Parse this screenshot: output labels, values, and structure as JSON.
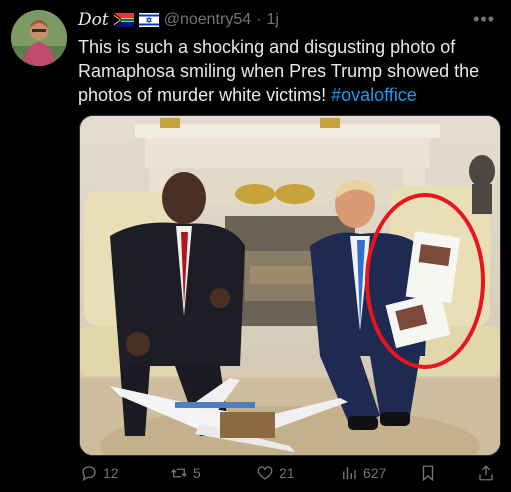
{
  "post": {
    "author_name": "Dot",
    "handle": "@noentry54",
    "separator": "·",
    "time": "1j",
    "more_label": "•••",
    "text": "This is such a shocking and disgusting photo of Ramaphosa smiling when Pres Trump showed the photos of murder white victims! ",
    "hashtag": "#ovaloffice",
    "flags": [
      "south-africa-flag",
      "israel-flag"
    ]
  },
  "actions": {
    "replies": "12",
    "reposts": "5",
    "likes": "21",
    "views": "627"
  },
  "colors": {
    "background": "#000000",
    "text": "#e7e9ea",
    "muted": "#71767b",
    "link": "#1d9bf0",
    "highlight_circle": "#e8141e"
  },
  "icons": [
    "reply-icon",
    "repost-icon",
    "like-icon",
    "views-icon",
    "bookmark-icon",
    "share-icon"
  ]
}
